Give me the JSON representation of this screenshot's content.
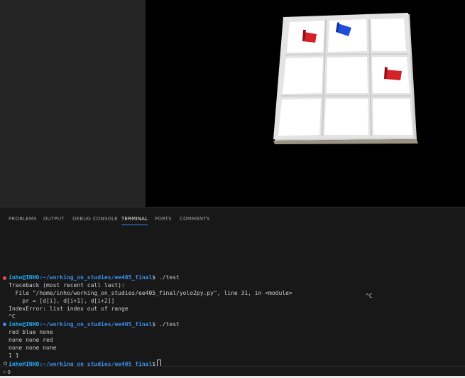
{
  "panel": {
    "tabs": [
      {
        "label": "PROBLEMS"
      },
      {
        "label": "OUTPUT"
      },
      {
        "label": "DEBUG CONSOLE"
      },
      {
        "label": "TERMINAL"
      },
      {
        "label": "PORTS"
      },
      {
        "label": "COMMENTS"
      }
    ],
    "active_tab": "TERMINAL"
  },
  "terminal": {
    "floating_text": "^C",
    "prompt_user": "inho@INHO",
    "prompt_path": ":~/working_on_studies/ee405_final",
    "prompt_suffix": "$",
    "command1": " ./test",
    "traceback": [
      "Traceback (most recent call last):",
      "  File \"/home/inho/working_on_studies/ee405_final/yolo2py.py\", line 31, in <module>",
      "    pr = [d[i], d[i+1], d[i+2]]",
      "IndexError: list index out of range",
      "^C"
    ],
    "command2": " ./test",
    "output": [
      "red blue none",
      "none none red",
      "none none none",
      "1 1"
    ],
    "command3": ""
  },
  "status_bar": {
    "text": "⑂ 0"
  },
  "colors": {
    "error_marker": "#f14c4c",
    "success_marker": "#3b8eea",
    "prompt": "#23a9f2",
    "active_tab_underline": "#3b82f6",
    "red_block": "#d42027",
    "blue_block": "#1f4fd6"
  }
}
